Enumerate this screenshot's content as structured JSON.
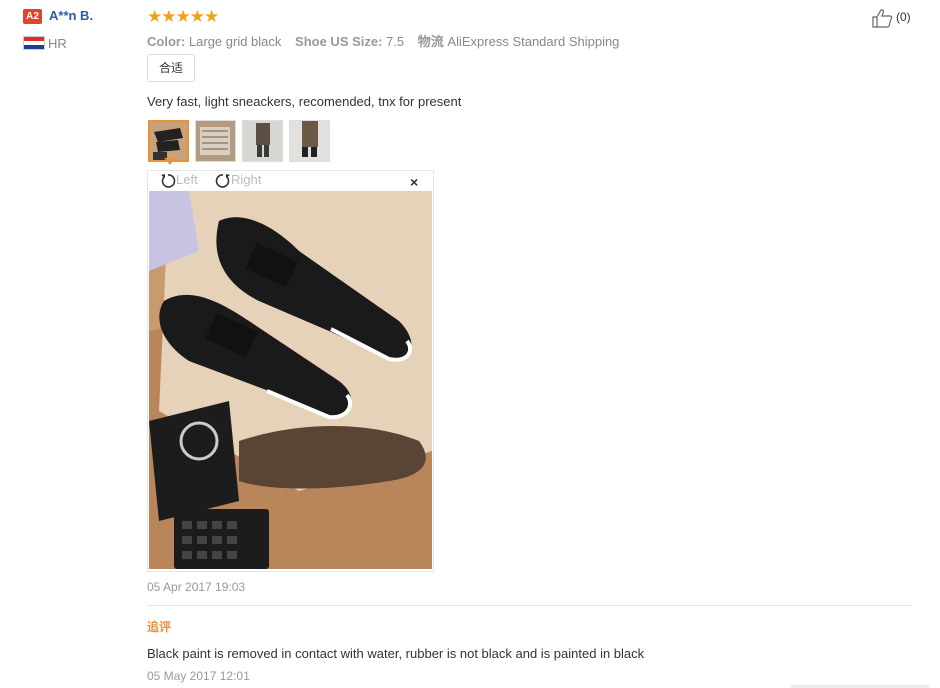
{
  "reviewer": {
    "level_badge": "A2",
    "name": "A**n B.",
    "country_code": "HR",
    "flag_colors": [
      "#e02b2b",
      "#ffffff",
      "#1c3f94"
    ]
  },
  "review": {
    "rating_stars": "★★★★★",
    "rating_value": 5,
    "color_label": "Color:",
    "color_value": "Large grid black",
    "size_label": "Shoe US Size:",
    "size_value": "7.5",
    "shipping_label": "物流",
    "shipping_value": "AliExpress Standard Shipping",
    "fit_tag": "合适",
    "text": "Very fast, light sneackers, recomended, tnx for present",
    "date": "05 Apr 2017 19:03"
  },
  "viewer": {
    "rotate_left_label": "Left",
    "rotate_right_label": "Right",
    "close_label": "×"
  },
  "followup": {
    "label": "追评",
    "text": "Black paint is removed in contact with water, rubber is not black and is painted in black",
    "date": "05 May 2017 12:01"
  },
  "helpful": {
    "count": "(0)"
  },
  "colors": {
    "star": "#f0a21a",
    "accent_orange": "#e8923a",
    "name_blue": "#2a5ba5",
    "badge_red": "#e0432e"
  }
}
